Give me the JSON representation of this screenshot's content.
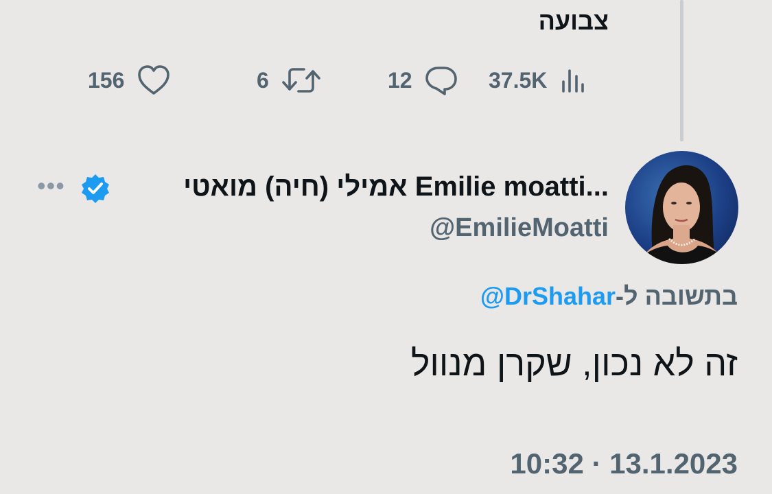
{
  "previous_tweet": {
    "text": "צבועה",
    "metrics": {
      "views": "37.5K",
      "replies": "12",
      "retweets": "6",
      "likes": "156"
    }
  },
  "tweet": {
    "display_name": "אמילי (חיה) מואטי Emilie moatti...",
    "handle": "@EmilieMoatti",
    "replying_to_label": "בתשובה ל-",
    "replying_to_handle": "@DrShahar",
    "text": "זה לא נכון, שקרן מנוול",
    "timestamp": "10:32 · 13.1.2023",
    "verified": true,
    "avatar": "profile-photo",
    "more_icon": "more-dots-icon"
  },
  "colors": {
    "background": "#eae8e7",
    "text": "#0f1419",
    "secondary_text": "#536471",
    "link": "#1d9bf0",
    "verified_badge": "#1d9bf0",
    "thread_line": "#c9cdd1"
  },
  "icons": {
    "views": "views-icon",
    "reply": "reply-icon",
    "retweet": "retweet-icon",
    "like": "like-icon",
    "verified": "verified-badge-icon"
  }
}
